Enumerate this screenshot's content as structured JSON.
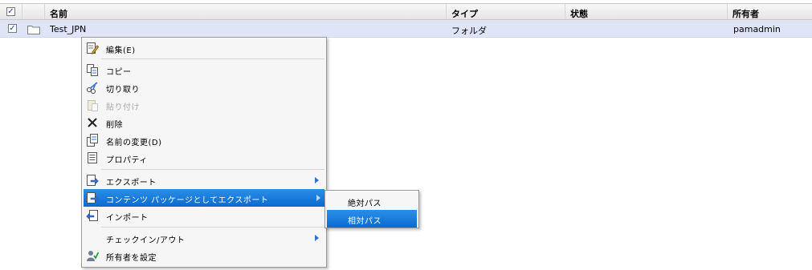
{
  "header": {
    "select_all_mark": "✓",
    "columns": [
      "名前",
      "タイプ",
      "状態",
      "所有者"
    ]
  },
  "row": {
    "check_mark": "✓",
    "name": "Test_JPN",
    "type": "フォルダ",
    "status": "",
    "owner": "pamadmin"
  },
  "context_menu": {
    "items": [
      {
        "label": "編集(E)",
        "icon": "edit-icon"
      },
      {
        "label": "コピー",
        "icon": "copy-icon"
      },
      {
        "label": "切り取り",
        "icon": "scissors-icon"
      },
      {
        "label": "貼り付け",
        "icon": "paste-icon",
        "disabled": true
      },
      {
        "label": "削除",
        "icon": "delete-x-icon"
      },
      {
        "label": "名前の変更(D)",
        "icon": "rename-icon"
      },
      {
        "label": "プロパティ",
        "icon": "properties-icon"
      },
      {
        "label": "エクスポート",
        "icon": "export-icon",
        "submenu": true
      },
      {
        "label": "コンテンツ パッケージとしてエクスポート",
        "icon": "export-package-icon",
        "submenu": true,
        "selected": true
      },
      {
        "label": "インポート",
        "icon": "import-icon"
      },
      {
        "label": "チェックイン/アウト",
        "icon": "",
        "submenu": true
      },
      {
        "label": "所有者を設定",
        "icon": "set-owner-icon"
      }
    ]
  },
  "submenu": {
    "items": [
      {
        "label": "絶対パス"
      },
      {
        "label": "相対パス",
        "selected": true
      }
    ]
  },
  "colors": {
    "selection": "#1a7ddc",
    "row_highlight": "#dfe4f7",
    "submenu_arrow": "#2f6fd8"
  }
}
